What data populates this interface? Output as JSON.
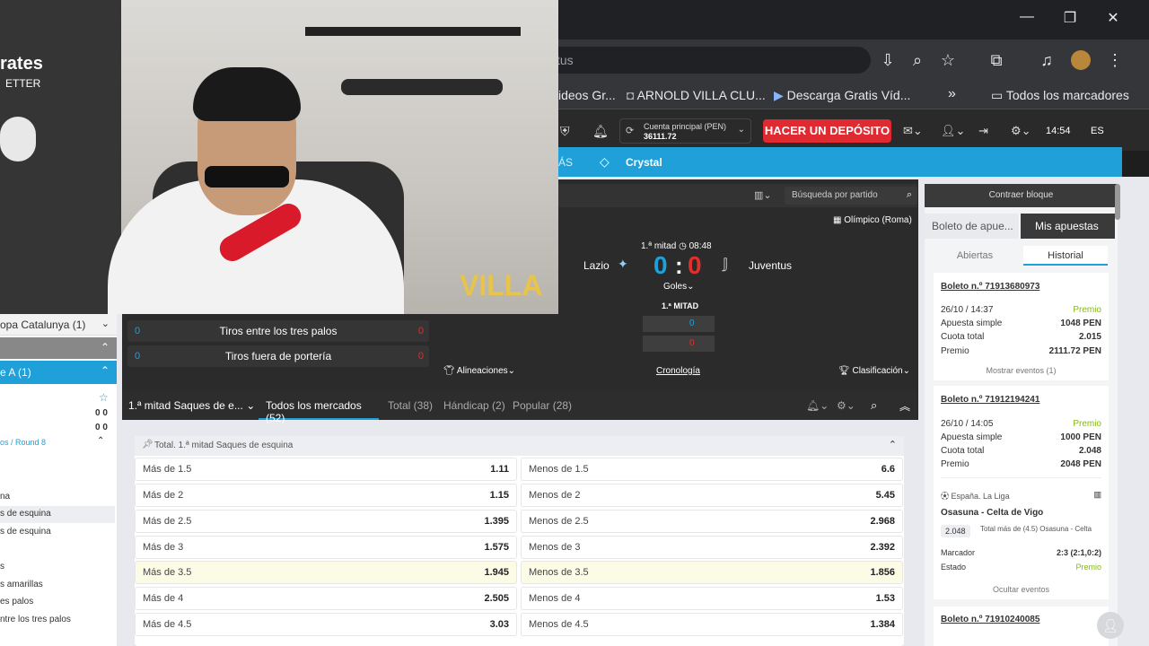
{
  "browser": {
    "omnibox_text": "tus",
    "bookmarks": [
      "ideos Gr...",
      "ARNOLD VILLA CLU...",
      "Descarga Gratis Víd...",
      "Todos los marcadores"
    ],
    "window_controls": [
      "—",
      "❐",
      "✕"
    ]
  },
  "header": {
    "account_label": "Cuenta principal (PEN)",
    "balance": "36111.72",
    "deposit_button": "HACER UN DEPÓSITO",
    "time": "14:54",
    "language": "ES"
  },
  "nav": {
    "more": "ÁS",
    "crystal": "Crystal"
  },
  "match": {
    "search_placeholder": "Búsqueda por partido",
    "stadium": "Olímpico (Roma)",
    "period": "1.ª mitad",
    "clock": "08:48",
    "home": "Lazio",
    "away": "Juventus",
    "home_score": "0",
    "away_score": "0",
    "goals_label": "Goles",
    "half_label": "1.ª MITAD",
    "half_home": "0",
    "half_away": "0",
    "links": [
      "Alineaciones",
      "Cronología",
      "Clasificación"
    ],
    "stats": [
      {
        "left": "0",
        "label": "Tiros entre los tres palos",
        "right": "0"
      },
      {
        "left": "0",
        "label": "Tiros fuera de portería",
        "right": "0"
      }
    ]
  },
  "left_panel": {
    "items": [
      "opa Catalunya (1)",
      "e A (1)"
    ],
    "scores": [
      "0 0",
      "0 0"
    ],
    "round": "os / Round 8",
    "markets": [
      "na",
      "s de esquina",
      "s de esquina",
      "s",
      "s amarillas",
      "es palos",
      "ntre los tres palos"
    ]
  },
  "market_tabs": {
    "selected": "1.ª mitad Saques de e...",
    "tabs": [
      "Todos los mercados (52)",
      "Total (38)",
      "Hándicap (2)",
      "Popular (28)"
    ]
  },
  "market": {
    "title": "Total. 1.ª mitad Saques de esquina",
    "rows": [
      {
        "over": "Más de 1.5",
        "over_odd": "1.11",
        "under": "Menos de 1.5",
        "under_odd": "6.6"
      },
      {
        "over": "Más de 2",
        "over_odd": "1.15",
        "under": "Menos de 2",
        "under_odd": "5.45"
      },
      {
        "over": "Más de 2.5",
        "over_odd": "1.395",
        "under": "Menos de 2.5",
        "under_odd": "2.968"
      },
      {
        "over": "Más de 3",
        "over_odd": "1.575",
        "under": "Menos de 3",
        "under_odd": "2.392"
      },
      {
        "over": "Más de 3.5",
        "over_odd": "1.945",
        "under": "Menos de 3.5",
        "under_odd": "1.856"
      },
      {
        "over": "Más de 4",
        "over_odd": "2.505",
        "under": "Menos de 4",
        "under_odd": "1.53"
      },
      {
        "over": "Más de 4.5",
        "over_odd": "3.03",
        "under": "Menos de 4.5",
        "under_odd": "1.384"
      }
    ]
  },
  "right_panel": {
    "collapse": "Contraer bloque",
    "tabs": [
      "Boleto de apue...",
      "Mis apuestas"
    ],
    "subtabs": [
      "Abiertas",
      "Historial"
    ],
    "tickets": [
      {
        "id": "Boleto n.º 71913680973",
        "date": "26/10 / 14:37",
        "status": "Premio",
        "type": "Apuesta simple",
        "stake": "1048 PEN",
        "odds_label": "Cuota total",
        "odds": "2.015",
        "prize_label": "Premio",
        "prize": "2111.72 PEN",
        "action": "Mostrar eventos (1)"
      },
      {
        "id": "Boleto n.º 71912194241",
        "date": "26/10 / 14:05",
        "status": "Premio",
        "type": "Apuesta simple",
        "stake": "1000 PEN",
        "odds_label": "Cuota total",
        "odds": "2.048",
        "prize_label": "Premio",
        "prize": "2048 PEN",
        "action": "Ocultar eventos"
      }
    ],
    "event": {
      "league": "España. La Liga",
      "match": "Osasuna - Celta de Vigo",
      "odd": "2.048",
      "pick": "Total más de (4.5) Osasuna - Celta",
      "score_label": "Marcador",
      "score": "2:3 (2:1,0:2)",
      "state_label": "Estado",
      "state": "Premio"
    },
    "next_ticket": "Boleto n.º 71910240085"
  },
  "webcam": {
    "brand_text": "VILLA",
    "poster_text": "rates",
    "poster_text2": "ETTER"
  },
  "colors": {
    "blue_nav": "#1fa0d8",
    "deposit": "#e02a31",
    "win_green": "#86b817",
    "score_red": "#e0302c",
    "score_blue": "#1fa0d8"
  }
}
